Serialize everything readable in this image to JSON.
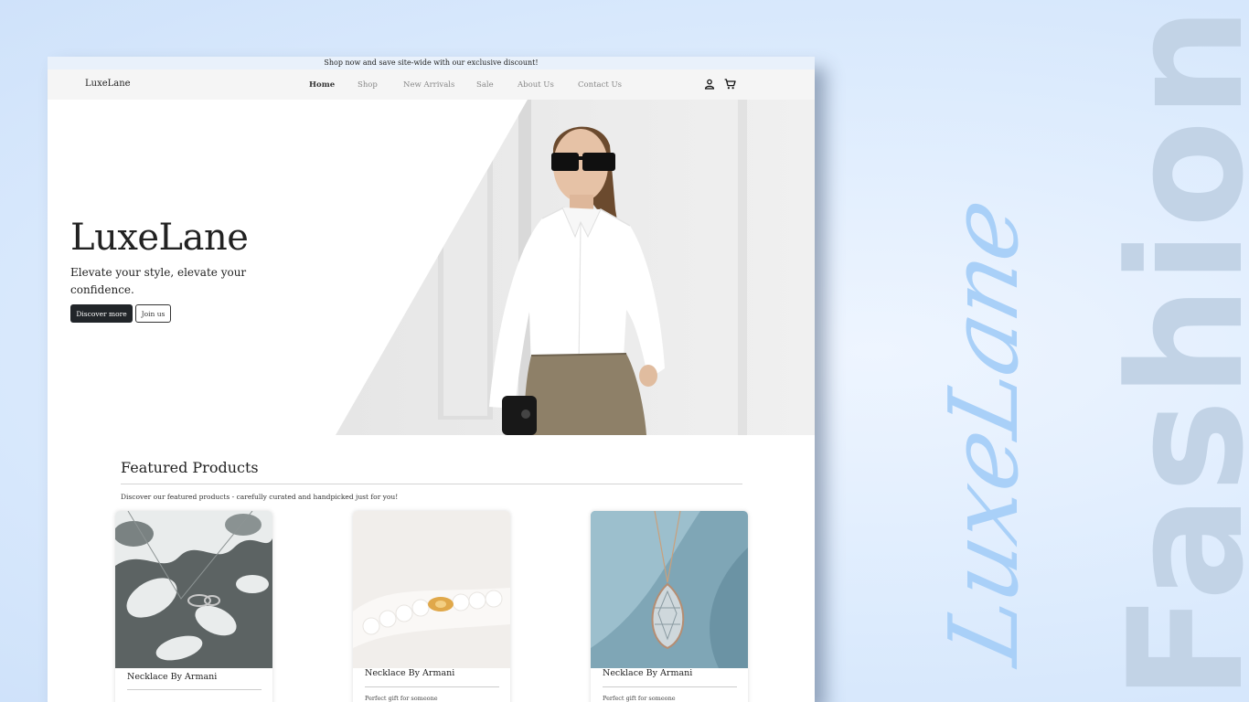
{
  "promo": {
    "text": "Shop now and save site-wide with our exclusive discount!"
  },
  "nav": {
    "brand": "LuxeLane",
    "links": [
      "Home",
      "Shop",
      "New Arrivals",
      "Sale",
      "About Us",
      "Contact Us"
    ],
    "active": "Home",
    "icons": [
      "user-icon",
      "cart-icon"
    ]
  },
  "hero": {
    "title": "LuxeLane",
    "subtitle": "Elevate your style, elevate your confidence.",
    "primary_button": "Discover more",
    "secondary_button": "Join us"
  },
  "featured": {
    "title": "Featured Products",
    "description": "Discover our featured products - carefully curated and handpicked just for you!",
    "products": [
      {
        "title": "Necklace By Armani",
        "description": ""
      },
      {
        "title": "Necklace By Armani",
        "description": "Perfect gift for someone"
      },
      {
        "title": "Necklace By Armani",
        "description": "Perfect gift for someone"
      }
    ]
  },
  "decor": {
    "script_text": "LuxeLane",
    "vertical_text": "Fashion"
  },
  "colors": {
    "background": "#dcebfd",
    "primary_button": "#212529",
    "navbar": "#f5f5f5",
    "promo_bar": "#e9f1fb",
    "accent_script": "#a9d0f8",
    "vertical_text": "#c2d3e6"
  }
}
